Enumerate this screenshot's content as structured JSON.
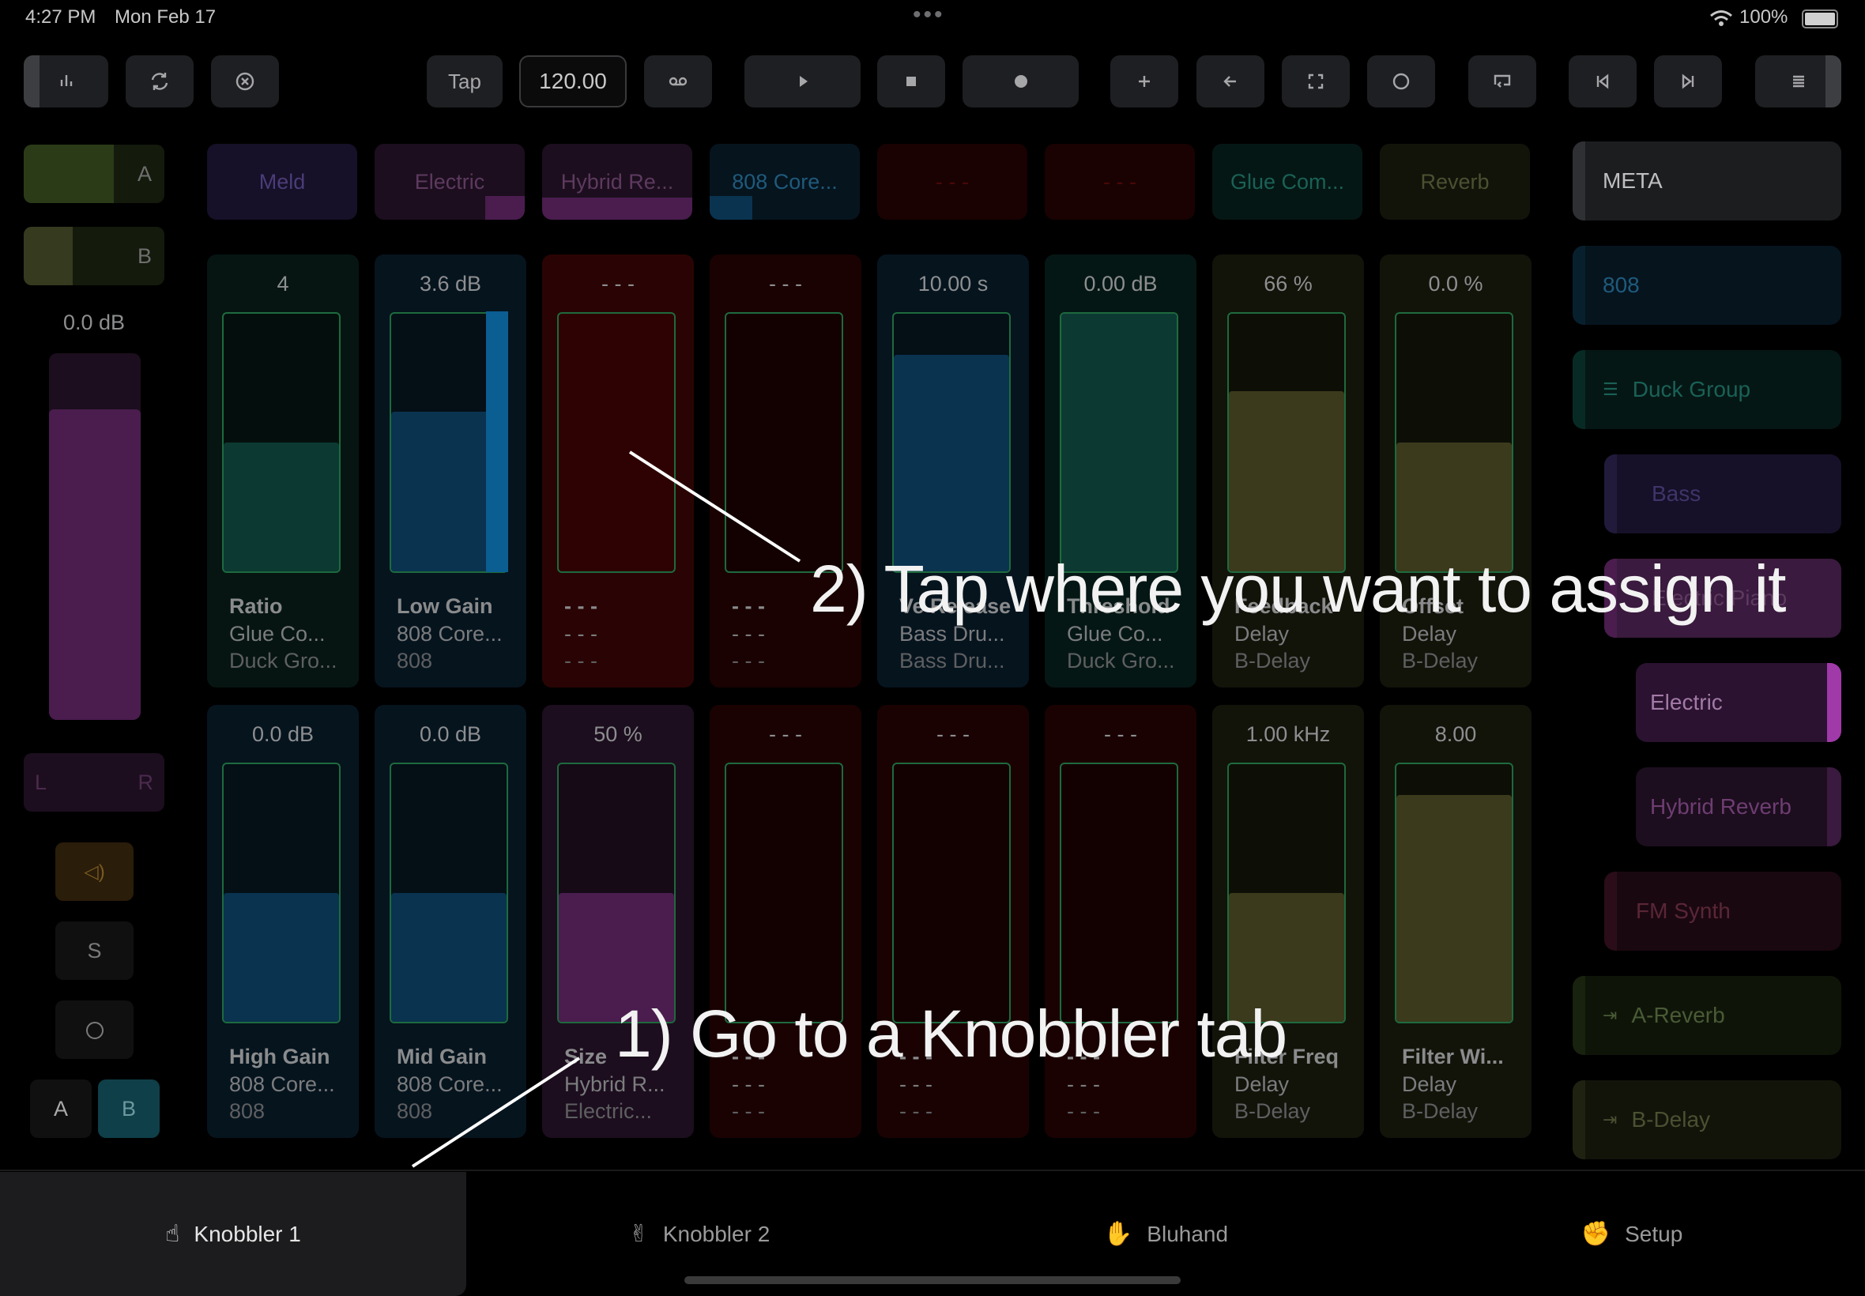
{
  "status_bar": {
    "time": "4:27 PM",
    "date": "Mon Feb 17",
    "battery": "100%"
  },
  "toolbar": {
    "tap_label": "Tap",
    "tempo": "120.00"
  },
  "left_strip": {
    "crossfader_a": "A",
    "crossfader_b": "B",
    "volume": "0.0 dB",
    "pan_left": "L",
    "pan_right": "R",
    "solo": "S",
    "ab_a": "A",
    "ab_b": "B"
  },
  "devices": [
    "Meld",
    "Electric",
    "Hybrid Re...",
    "808 Core...",
    "- - -",
    "- - -",
    "Glue Com...",
    "Reverb"
  ],
  "params_top": [
    {
      "value": "4",
      "name": "Ratio",
      "device": "Glue Co...",
      "track": "Duck Gro...",
      "level": 0.5
    },
    {
      "value": "3.6 dB",
      "name": "Low Gain",
      "device": "808 Core...",
      "track": "808",
      "level": 0.62
    },
    {
      "value": "- - -",
      "name": "- - -",
      "device": "- - -",
      "track": "- - -",
      "level": 0
    },
    {
      "value": "- - -",
      "name": "- - -",
      "device": "- - -",
      "track": "- - -",
      "level": 0
    },
    {
      "value": "10.00 s",
      "name": "Ve Release",
      "device": "Bass Dru...",
      "track": "Bass Dru...",
      "level": 0.84
    },
    {
      "value": "0.00 dB",
      "name": "Threshold",
      "device": "Glue Co...",
      "track": "Duck Gro...",
      "level": 1.0
    },
    {
      "value": "66 %",
      "name": "Feedback",
      "device": "Delay",
      "track": "B-Delay",
      "level": 0.7
    },
    {
      "value": "0.0 %",
      "name": "Offset",
      "device": "Delay",
      "track": "B-Delay",
      "level": 0.5
    }
  ],
  "params_bottom": [
    {
      "value": "0.0 dB",
      "name": "High Gain",
      "device": "808 Core...",
      "track": "808",
      "level": 0.5
    },
    {
      "value": "0.0 dB",
      "name": "Mid Gain",
      "device": "808 Core...",
      "track": "808",
      "level": 0.5
    },
    {
      "value": "50 %",
      "name": "Size",
      "device": "Hybrid R...",
      "track": "Electric...",
      "level": 0.5
    },
    {
      "value": "- - -",
      "name": "- - -",
      "device": "- - -",
      "track": "- - -",
      "level": 0
    },
    {
      "value": "- - -",
      "name": "- - -",
      "device": "- - -",
      "track": "- - -",
      "level": 0
    },
    {
      "value": "- - -",
      "name": "- - -",
      "device": "- - -",
      "track": "- - -",
      "level": 0
    },
    {
      "value": "1.00 kHz",
      "name": "Filter Freq",
      "device": "Delay",
      "track": "B-Delay",
      "level": 0.5
    },
    {
      "value": "8.00",
      "name": "Filter Wi...",
      "device": "Delay",
      "track": "B-Delay",
      "level": 0.88
    }
  ],
  "tracks": [
    "META",
    "808",
    "Duck Group",
    "Bass",
    "Electric Piano",
    "Electric",
    "Hybrid Reverb",
    "FM Synth",
    "A-Reverb",
    "B-Delay"
  ],
  "tabs": [
    {
      "label": "Knobbler 1",
      "icon": "pointing-finger-icon"
    },
    {
      "label": "Knobbler 2",
      "icon": "victory-hand-icon"
    },
    {
      "label": "Bluhand",
      "icon": "raised-hand-icon"
    },
    {
      "label": "Setup",
      "icon": "raised-fist-icon"
    }
  ],
  "annotations": {
    "step1": "1) Go to a Knobbler tab",
    "step2": "2) Tap where you want to assign it"
  },
  "colors": {
    "green": "#1a2e0f",
    "purple": "#4a1d4e",
    "teal": "#0c3a33",
    "blue": "#0a3350",
    "red": "#3a0505",
    "olive": "#3b3a1c"
  }
}
